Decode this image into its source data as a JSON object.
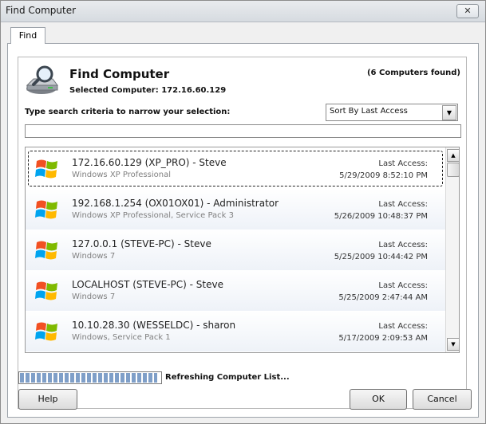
{
  "window": {
    "title": "Find Computer",
    "close_label": "✕"
  },
  "tabs": [
    {
      "label": "Find"
    }
  ],
  "header": {
    "title": "Find Computer",
    "selected_computer": "Selected Computer: 172.16.60.129",
    "found_count": "(6 Computers found)"
  },
  "search": {
    "label": "Type search criteria to narrow your selection:",
    "value": "",
    "sort_value": "Sort By Last Access"
  },
  "computers": [
    {
      "name": "172.16.60.129 (XP_PRO) - Steve",
      "os": "Windows XP Professional",
      "last_access_label": "Last Access:",
      "last_access": "5/29/2009 8:52:10 PM",
      "selected": true
    },
    {
      "name": "192.168.1.254 (OX01OX01) - Administrator",
      "os": "Windows XP Professional, Service Pack 3",
      "last_access_label": "Last Access:",
      "last_access": "5/26/2009 10:48:37 PM"
    },
    {
      "name": "127.0.0.1 (STEVE-PC) - Steve",
      "os": "Windows 7",
      "last_access_label": "Last Access:",
      "last_access": "5/25/2009 10:44:42 PM"
    },
    {
      "name": "LOCALHOST (STEVE-PC) - Steve",
      "os": "Windows 7",
      "last_access_label": "Last Access:",
      "last_access": "5/25/2009 2:47:44 AM"
    },
    {
      "name": "10.10.28.30 (WESSELDC) - sharon",
      "os": "Windows, Service Pack 1",
      "last_access_label": "Last Access:",
      "last_access": "5/17/2009 2:09:53 AM"
    }
  ],
  "status": {
    "text": "Refreshing Computer List...",
    "progress": 0.98
  },
  "buttons": {
    "help": "Help",
    "ok": "OK",
    "cancel": "Cancel"
  }
}
